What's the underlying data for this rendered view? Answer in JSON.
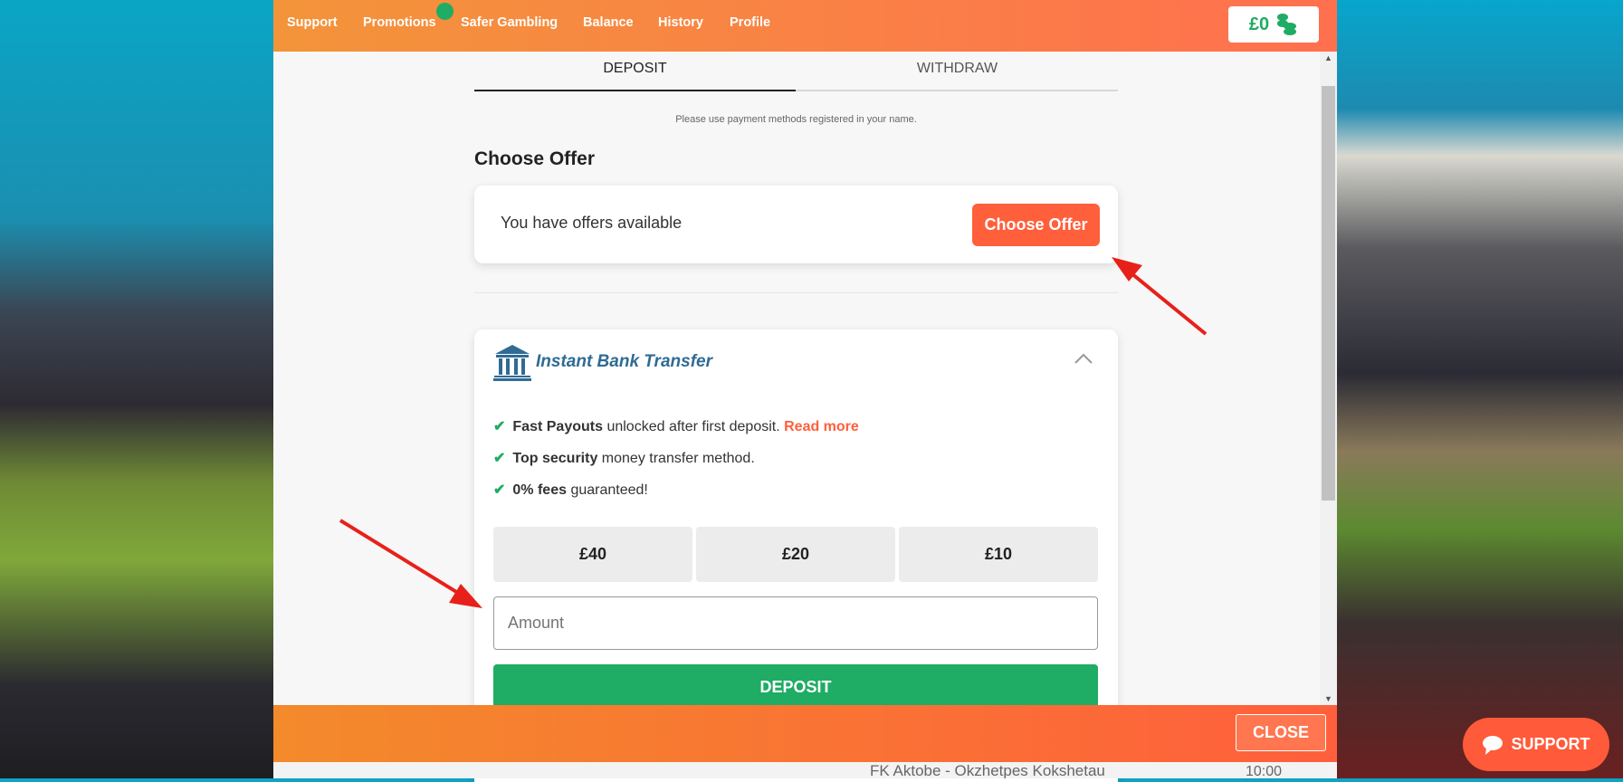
{
  "nav": {
    "items": [
      "Support",
      "Promotions",
      "Safer Gambling",
      "Balance",
      "History",
      "Profile"
    ],
    "balance": "£0"
  },
  "tabs": {
    "deposit": "DEPOSIT",
    "withdraw": "WITHDRAW"
  },
  "note": "Please use payment methods registered in your name.",
  "offer": {
    "heading": "Choose Offer",
    "text": "You have offers available",
    "button": "Choose Offer"
  },
  "method": {
    "title": "Instant Bank Transfer",
    "bullets": [
      {
        "bold": "Fast Payouts",
        "rest": " unlocked after first deposit. ",
        "link": "Read more"
      },
      {
        "bold": "Top security",
        "rest": " money transfer method."
      },
      {
        "bold": "0% fees",
        "rest": " guaranteed!"
      }
    ],
    "amounts": [
      "£40",
      "£20",
      "£10"
    ],
    "amount_placeholder": "Amount",
    "deposit": "DEPOSIT"
  },
  "footer": {
    "close": "CLOSE"
  },
  "behind": {
    "match": "FK Aktobe - Okzhetpes Kokshetau",
    "time": "10:00"
  },
  "support": "SUPPORT",
  "colors": {
    "accent": "#ff5f3a",
    "green": "#1fac64",
    "brand_blue": "#2f6b94"
  }
}
